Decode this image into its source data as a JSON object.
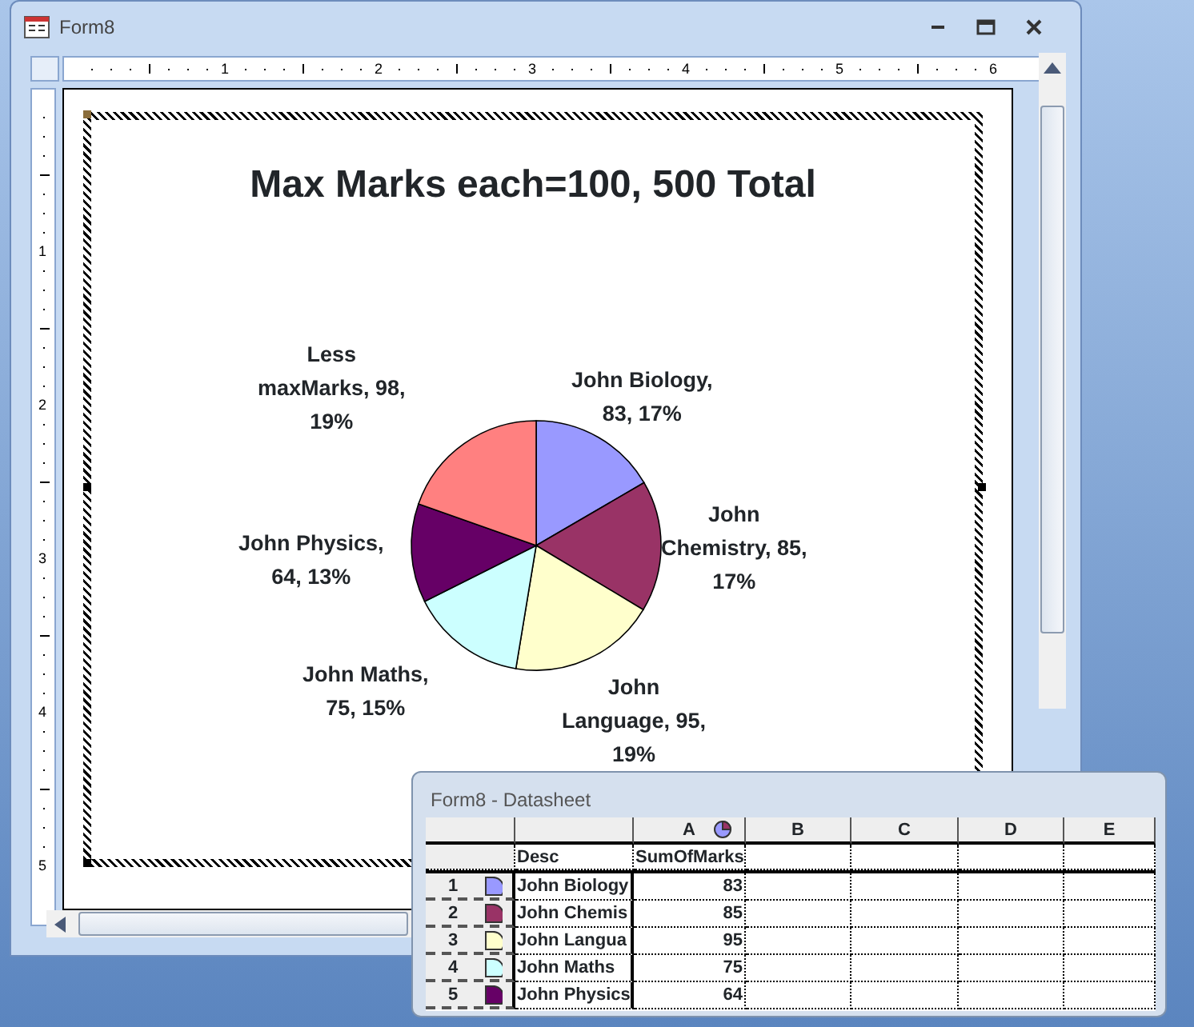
{
  "main_window": {
    "title": "Form8",
    "horizontal_ruler": [
      "1",
      "2",
      "3",
      "4",
      "5",
      "6"
    ],
    "vertical_ruler": [
      "1",
      "2",
      "3",
      "4",
      "5"
    ],
    "chart_data": {
      "type": "pie",
      "title": "Max Marks each=100, 500 Total",
      "values": [
        83,
        85,
        95,
        75,
        64,
        98
      ],
      "colors": [
        "#9999ff",
        "#993366",
        "#ffffcc",
        "#ccffff",
        "#660066",
        "#ff8080"
      ],
      "value_labels": [
        "John Biology,\n83, 17%",
        "John\nChemistry, 85,\n17%",
        "John\nLanguage, 95,\n19%",
        "John Maths,\n75, 15%",
        "John Physics,\n64, 13%",
        "Less\nmaxMarks, 98,\n19%"
      ]
    }
  },
  "datasheet": {
    "title": "Form8 - Datasheet",
    "columns": [
      "A",
      "B",
      "C",
      "D",
      "E"
    ],
    "fields": [
      "Desc",
      "SumOfMarks"
    ],
    "rows": [
      {
        "number": "1",
        "color": "#9999ff",
        "desc": "John Biology",
        "value": "83"
      },
      {
        "number": "2",
        "color": "#993366",
        "desc": "John Chemis",
        "value": "85"
      },
      {
        "number": "3",
        "color": "#ffffcc",
        "desc": "John Langua",
        "value": "95"
      },
      {
        "number": "4",
        "color": "#ccffff",
        "desc": "John Maths",
        "value": "75"
      },
      {
        "number": "5",
        "color": "#660066",
        "desc": "John Physics",
        "value": "64"
      }
    ]
  }
}
